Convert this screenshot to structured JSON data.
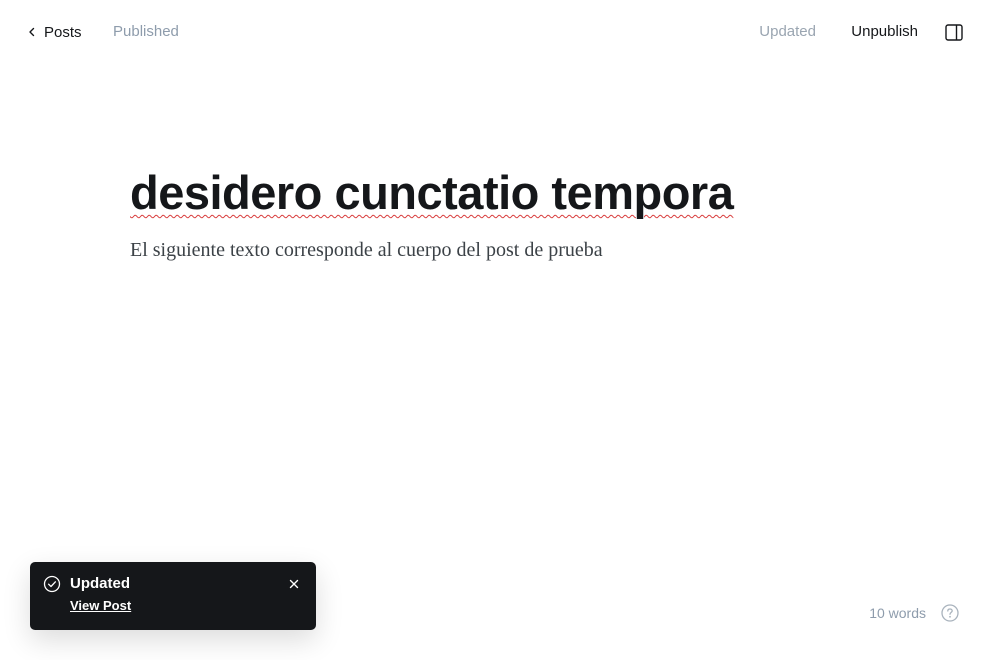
{
  "header": {
    "back_label": "Posts",
    "status": "Published",
    "save_state": "Updated",
    "unpublish_label": "Unpublish",
    "sidebar_toggle_icon": "sidebar-panel-icon"
  },
  "editor": {
    "title": "desidero cunctatio tempora",
    "body": "El siguiente texto corresponde al cuerpo del post de prueba"
  },
  "toast": {
    "title": "Updated",
    "link_label": "View Post",
    "icon": "check-circle-icon",
    "close_icon": "close-icon"
  },
  "footer": {
    "word_count": "10 words",
    "help_icon": "question-circle-icon"
  },
  "colors": {
    "toast_background": "#15171a",
    "muted_text": "#8e9cac",
    "spellcheck_underline": "#d83b3b"
  }
}
